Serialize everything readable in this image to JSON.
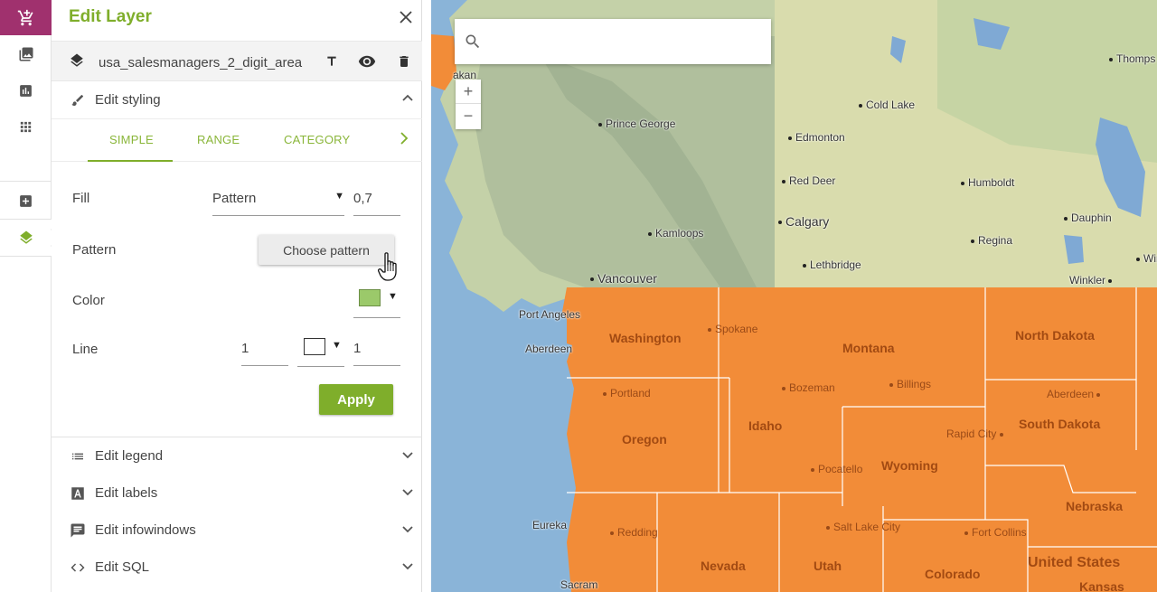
{
  "rail": {
    "items": [
      {
        "name": "cart-icon"
      },
      {
        "name": "image-icon"
      },
      {
        "name": "chart-icon"
      },
      {
        "name": "grid-icon"
      },
      {
        "name": "add-icon"
      },
      {
        "name": "layers-icon"
      }
    ]
  },
  "panel": {
    "title": "Edit Layer",
    "layer_name": "usa_salesmanagers_2_digit_area",
    "styling_section": "Edit styling",
    "tabs": [
      "SIMPLE",
      "RANGE",
      "CATEGORY"
    ],
    "active_tab": "SIMPLE",
    "fill_label": "Fill",
    "fill_type": "Pattern",
    "fill_opacity": "0,7",
    "pattern_label": "Pattern",
    "choose_pattern_button": "Choose pattern",
    "color_label": "Color",
    "fill_color": "#9bc96a",
    "line_label": "Line",
    "line_width": "1",
    "line_color": "#ffffff",
    "line_opacity": "1",
    "apply_button": "Apply",
    "sections": [
      {
        "label": "Edit legend",
        "icon": "list-icon"
      },
      {
        "label": "Edit labels",
        "icon": "label-a-icon"
      },
      {
        "label": "Edit infowindows",
        "icon": "comment-icon"
      },
      {
        "label": "Edit SQL",
        "icon": "code-icon"
      }
    ]
  },
  "map": {
    "search_placeholder": "",
    "zoom_in": "+",
    "zoom_out": "−",
    "cities": [
      {
        "name": "Prince George"
      },
      {
        "name": "Cold Lake"
      },
      {
        "name": "Edmonton"
      },
      {
        "name": "Red Deer"
      },
      {
        "name": "Humboldt"
      },
      {
        "name": "Calgary"
      },
      {
        "name": "Dauphin"
      },
      {
        "name": "Kamloops"
      },
      {
        "name": "Regina"
      },
      {
        "name": "Lethbridge"
      },
      {
        "name": "Vancouver"
      },
      {
        "name": "Winkler"
      },
      {
        "name": "Port Angeles"
      },
      {
        "name": "Aberdeen"
      },
      {
        "name": "Eureka"
      },
      {
        "name": "Thomps"
      },
      {
        "name": "Winn"
      },
      {
        "name": "akan"
      },
      {
        "name": "Sacram"
      }
    ],
    "states": [
      {
        "name": "Washington"
      },
      {
        "name": "Montana"
      },
      {
        "name": "North Dakota"
      },
      {
        "name": "Idaho"
      },
      {
        "name": "Oregon"
      },
      {
        "name": "South Dakota"
      },
      {
        "name": "Wyoming"
      },
      {
        "name": "Nebraska"
      },
      {
        "name": "Nevada"
      },
      {
        "name": "Utah"
      },
      {
        "name": "Colorado"
      },
      {
        "name": "United States"
      },
      {
        "name": "Kansas"
      }
    ],
    "us_cities": [
      {
        "name": "Spokane"
      },
      {
        "name": "Portland"
      },
      {
        "name": "Bozeman"
      },
      {
        "name": "Billings"
      },
      {
        "name": "Aberdeen"
      },
      {
        "name": "Rapid City"
      },
      {
        "name": "Pocatello"
      },
      {
        "name": "Salt Lake City"
      },
      {
        "name": "Fort Collins"
      },
      {
        "name": "Redding"
      }
    ]
  }
}
